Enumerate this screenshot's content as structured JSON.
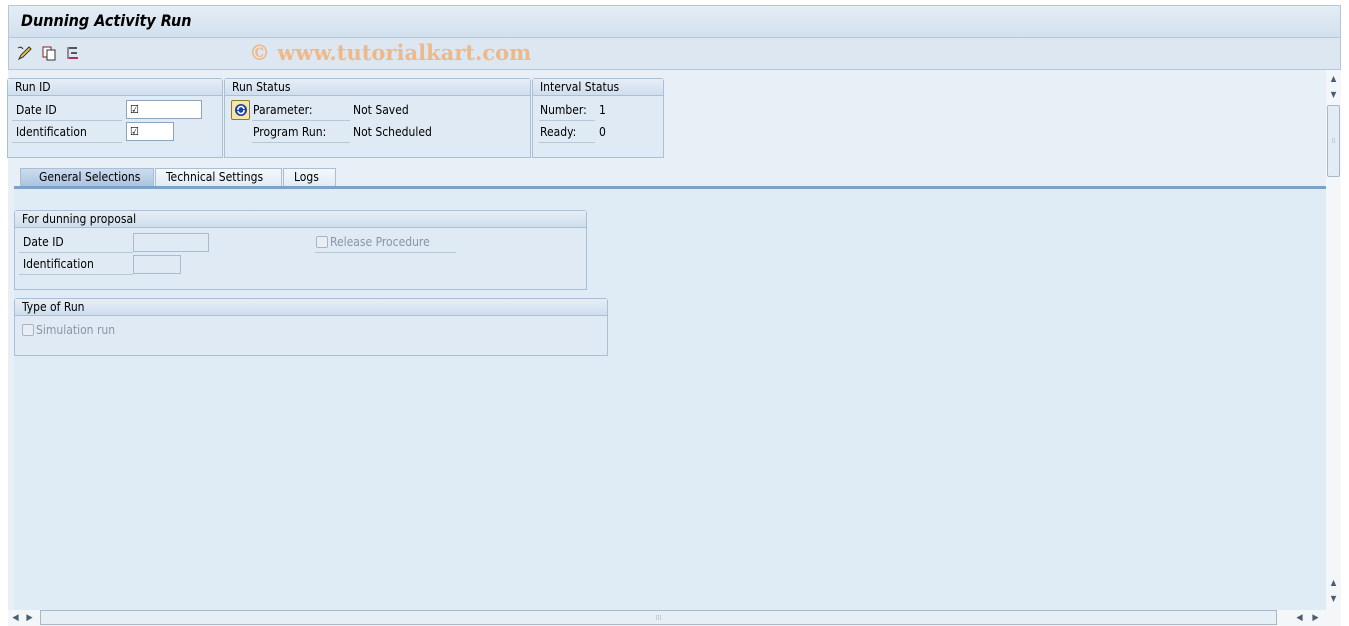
{
  "window": {
    "title": "Dunning Activity Run"
  },
  "toolbar": {
    "icons": [
      "edit-pencil-icon",
      "copy-icon",
      "structure-list-icon"
    ],
    "watermark": "© www.tutorialkart.com"
  },
  "run_id": {
    "title": "Run ID",
    "date_id_label": "Date ID",
    "identification_label": "Identification",
    "date_id_value": "☑",
    "identification_value": "☑"
  },
  "run_status": {
    "title": "Run Status",
    "parameter_label": "Parameter:",
    "parameter_value": "Not Saved",
    "program_run_label": "Program Run:",
    "program_run_value": "Not Scheduled",
    "refresh_icon": "refresh-icon"
  },
  "interval_status": {
    "title": "Interval Status",
    "number_label": "Number:",
    "number_value": "1",
    "ready_label": "Ready:",
    "ready_value": "0"
  },
  "tabs": [
    {
      "label": "General Selections",
      "active": true
    },
    {
      "label": "Technical Settings",
      "active": false
    },
    {
      "label": "Logs",
      "active": false
    }
  ],
  "dunning_proposal": {
    "title": "For dunning proposal",
    "date_id_label": "Date ID",
    "identification_label": "Identification",
    "date_id_value": "",
    "identification_value": "",
    "release_procedure_label": "Release Procedure",
    "release_procedure_checked": false
  },
  "type_of_run": {
    "title": "Type of Run",
    "simulation_run_label": "Simulation run",
    "simulation_run_checked": false
  }
}
